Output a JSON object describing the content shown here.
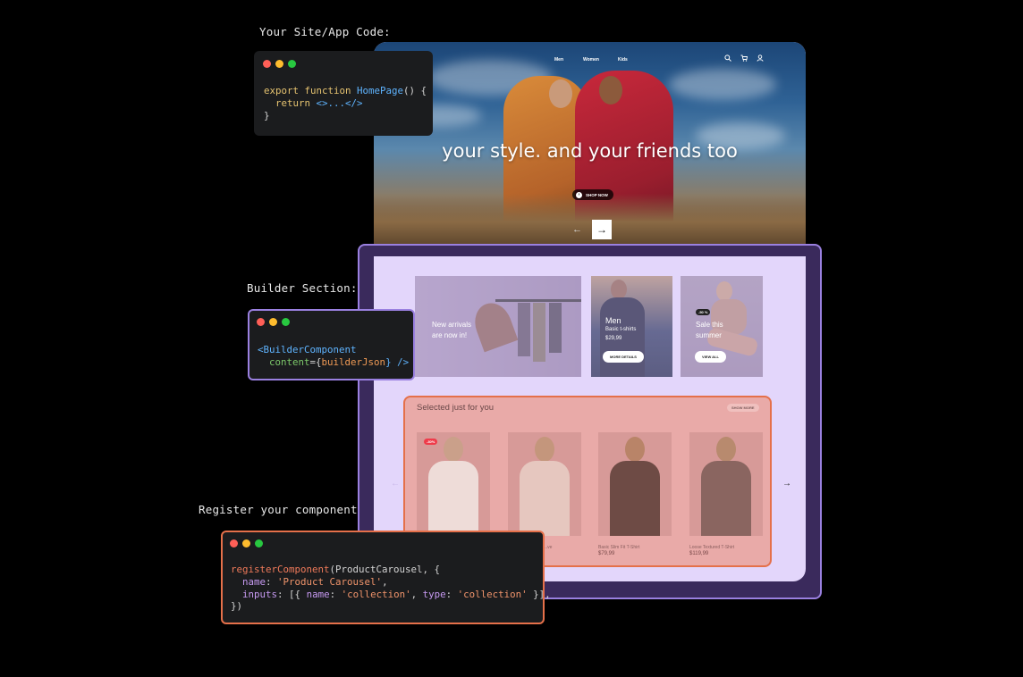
{
  "captions": {
    "site_code": "Your Site/App Code:",
    "builder_section": "Builder Section:",
    "register": "Register your components:"
  },
  "colors": {
    "dot_red": "#ff5f57",
    "dot_yellow": "#febc2e",
    "dot_green": "#28c840",
    "builder_border": "#9a80e0",
    "carousel_border": "#e5704a"
  },
  "code1": {
    "l1_kw": "export function",
    "l1_fn": "HomePage",
    "l1_rest": "() {",
    "l2_kw": "return",
    "l2_frag": "<>...</>",
    "l3": "}"
  },
  "code2": {
    "l1": "<BuilderComponent",
    "l2_attr": "content",
    "l2_eq": "={",
    "l2_val": "builderJson",
    "l2_end": "} />"
  },
  "code3": {
    "l1_fn": "registerComponent",
    "l1_rest": "(ProductCarousel, {",
    "l2_key": "name",
    "l2_val": "'Product Carousel'",
    "l2_end": ",",
    "l3_key": "inputs",
    "l3_open": ": [{",
    "l3_k1": "name",
    "l3_v1": "'collection'",
    "l3_k2": "type",
    "l3_v2": "'collection'",
    "l3_close": " }],",
    "l4": "})"
  },
  "site": {
    "nav": [
      "Men",
      "Women",
      "Kids"
    ],
    "hero_title": "your style. and your friends too",
    "shop_now": "SHOP NOW",
    "cards": [
      {
        "title_line1": "New arrivals",
        "title_line2": "are now in!"
      },
      {
        "title": "Men",
        "subtitle": "Basic t-shirts",
        "price": "$29,99",
        "cta": "MORE DETAILS"
      },
      {
        "badge": "-50 %",
        "title_line1": "Sale this",
        "title_line2": "summer",
        "cta": "VIEW ALL"
      }
    ],
    "carousel": {
      "title": "Selected just for you",
      "show_more": "SHOW MORE",
      "sale_badge": "-30%",
      "products": [
        {
          "name": "",
          "price": ""
        },
        {
          "name": "...ve",
          "price": ""
        },
        {
          "name": "Basic Slim Fit T-Shirt",
          "price": "$79,99"
        },
        {
          "name": "Loose Textured T-Shirt",
          "price": "$119,99"
        }
      ]
    }
  }
}
